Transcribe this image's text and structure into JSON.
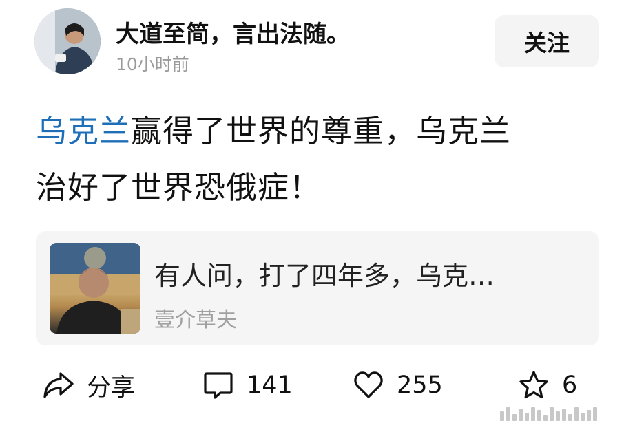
{
  "author": {
    "name": "大道至简，言出法随。",
    "time": "10小时前",
    "follow_label": "关注"
  },
  "post": {
    "topic_link_1": "乌克兰",
    "text_1": "赢得了世界的尊重，乌克兰",
    "text_2": "治好了世界恐俄症！"
  },
  "quote_card": {
    "text": "有人问，打了四年多，乌克…",
    "author": "壹介草夫"
  },
  "actions": {
    "share_label": "分享",
    "comment_count": "141",
    "like_count": "255",
    "favorite_count": "6"
  },
  "icons": {
    "share": "share-icon",
    "comment": "comment-icon",
    "like": "heart-icon",
    "favorite": "star-icon"
  },
  "colors": {
    "topic_link": "#1e6fb8",
    "time_text": "#9a9a9a",
    "card_background": "#f5f5f5"
  }
}
